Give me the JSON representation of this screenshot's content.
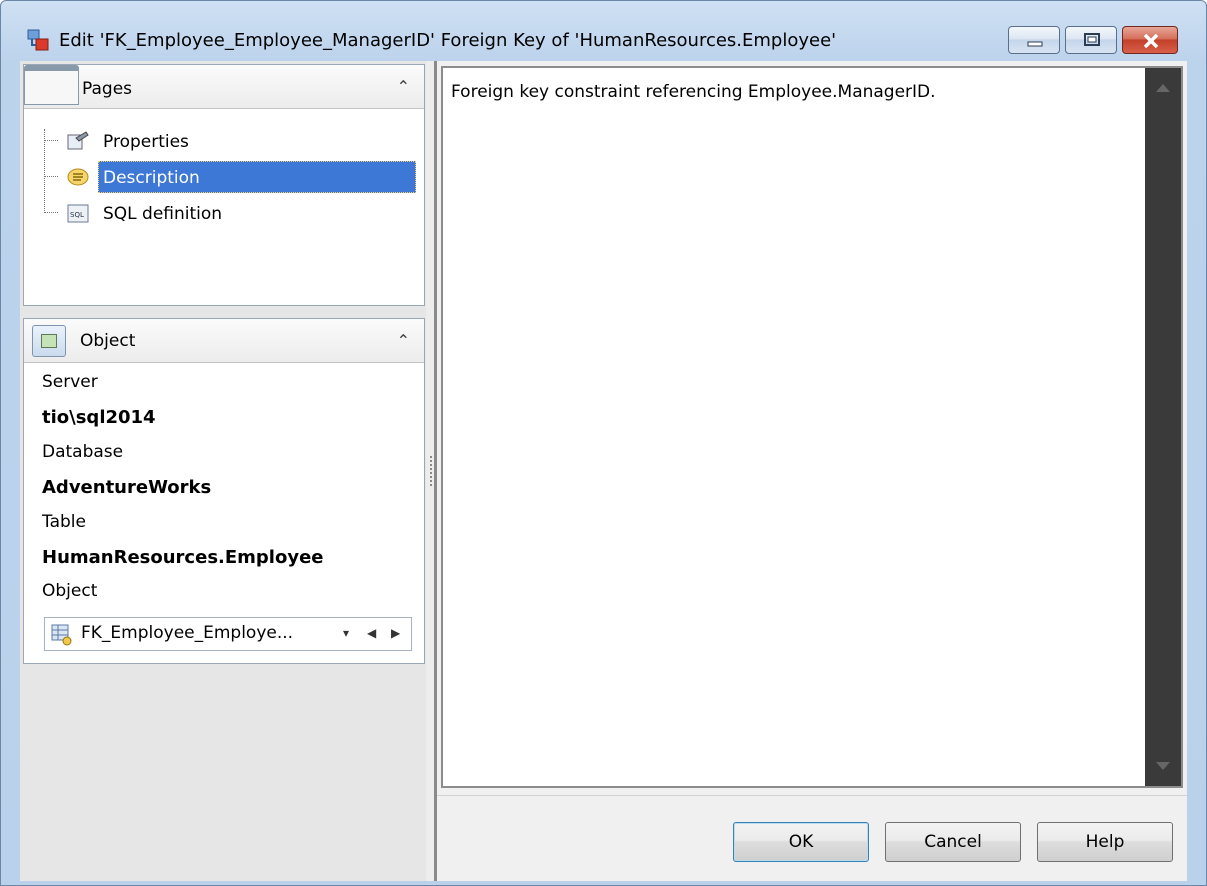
{
  "window": {
    "title": "Edit 'FK_Employee_Employee_ManagerID' Foreign Key of 'HumanResources.Employee'",
    "icon": "foreign-key-icon"
  },
  "pages_panel": {
    "header": "Pages",
    "items": [
      {
        "label": "Properties",
        "icon": "properties-icon",
        "selected": false
      },
      {
        "label": "Description",
        "icon": "description-icon",
        "selected": true
      },
      {
        "label": "SQL definition",
        "icon": "sql-icon",
        "selected": false
      }
    ]
  },
  "object_panel": {
    "header": "Object",
    "server_label": "Server",
    "server_value": "tio\\sql2014",
    "database_label": "Database",
    "database_value": "AdventureWorks",
    "table_label": "Table",
    "table_value": "HumanResources.Employee",
    "object_label": "Object",
    "object_value": "FK_Employee_Employe..."
  },
  "editor": {
    "text": "Foreign key constraint referencing Employee.ManagerID."
  },
  "buttons": {
    "ok": "OK",
    "cancel": "Cancel",
    "help": "Help"
  },
  "colors": {
    "selection": "#3d78d7",
    "window_frame": "#b9d1ea",
    "close_button": "#c2412a"
  }
}
